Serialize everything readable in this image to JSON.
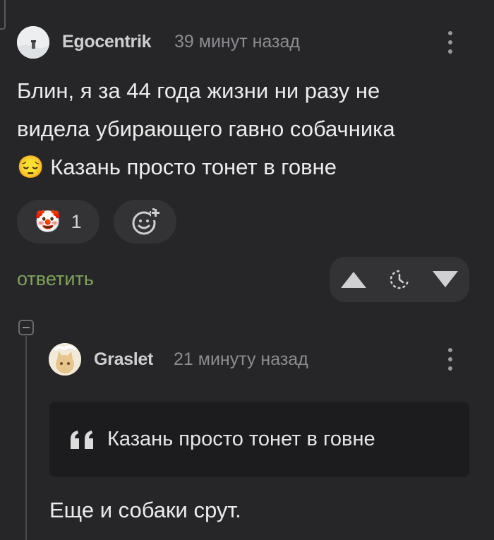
{
  "comment": {
    "username": "Egocentrik",
    "time": "39 минут назад",
    "text_line1": "Блин, я за 44 года жизни ни разу не",
    "text_line2": "видела убирающего гавно собачника",
    "text_line3": "😔 Казань просто тонет в говне",
    "reaction_emoji": "🤡",
    "reaction_count": "1",
    "reply_label": "ответить",
    "avatar_icon": "snowy-landscape-avatar"
  },
  "reply_comment": {
    "username": "Graslet",
    "time": "21 минуту назад",
    "quote_text": "Казань просто тонет в говне",
    "text": "Еще и собаки срут.",
    "avatar_icon": "cat-avatar"
  },
  "colors": {
    "background": "#262629",
    "accent_green": "#7fa35a",
    "pill": "#333336",
    "quote_bg": "#1c1c1e"
  }
}
